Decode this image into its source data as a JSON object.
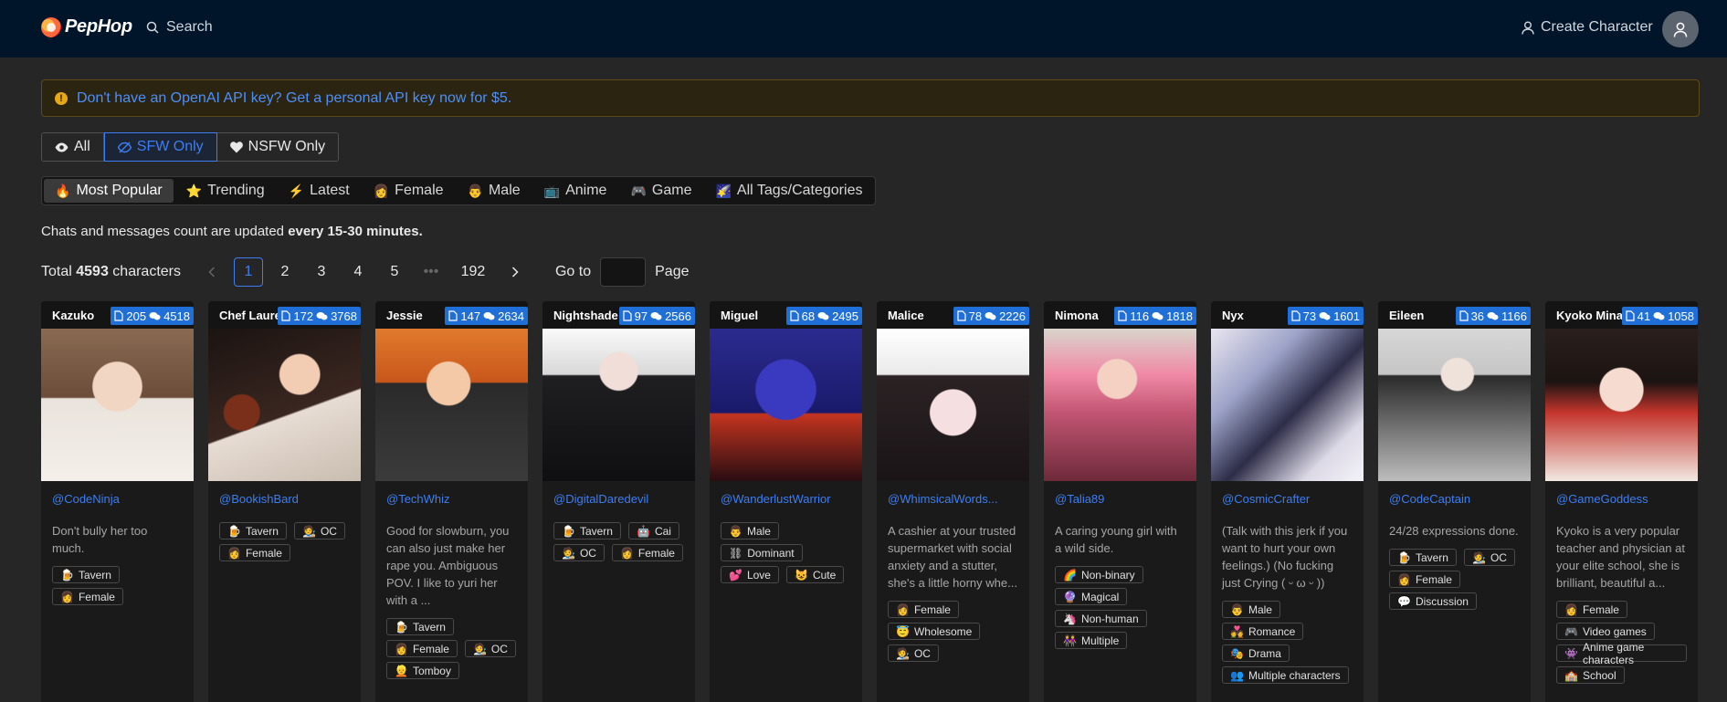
{
  "header": {
    "logo_text": "PepHop",
    "search_label": "Search",
    "create_label": "Create Character"
  },
  "banner": {
    "text": "Don't have an OpenAI API key? Get a personal API key now for $5."
  },
  "filters": [
    {
      "label": "All",
      "icon": "eye-icon"
    },
    {
      "label": "SFW Only",
      "icon": "eye-off-icon"
    },
    {
      "label": "NSFW Only",
      "icon": "heart-icon"
    }
  ],
  "categories": [
    {
      "label": "Most Popular",
      "emoji": "🔥"
    },
    {
      "label": "Trending",
      "emoji": "⭐"
    },
    {
      "label": "Latest",
      "emoji": "⚡"
    },
    {
      "label": "Female",
      "emoji": "👩"
    },
    {
      "label": "Male",
      "emoji": "👨"
    },
    {
      "label": "Anime",
      "emoji": "📺"
    },
    {
      "label": "Game",
      "emoji": "🎮"
    },
    {
      "label": "All Tags/Categories",
      "emoji": "🌠"
    }
  ],
  "notice": {
    "prefix": "Chats and messages count are updated ",
    "bold": "every 15-30 minutes."
  },
  "pagination": {
    "total_prefix": "Total ",
    "total_count": "4593",
    "total_suffix": " characters",
    "pages": [
      "1",
      "2",
      "3",
      "4",
      "5"
    ],
    "ellipsis": "•••",
    "last_page": "192",
    "goto_label": "Go to",
    "page_label": "Page"
  },
  "cards": [
    {
      "name": "Kazuko",
      "chats": "205",
      "messages": "4518",
      "author": "@CodeNinja",
      "desc": "Don't bully her too much.",
      "tags": [
        {
          "e": "🍺",
          "t": "Tavern"
        },
        {
          "e": "👩",
          "t": "Female"
        }
      ]
    },
    {
      "name": "Chef Lauren",
      "chats": "172",
      "messages": "3768",
      "author": "@BookishBard",
      "desc": "",
      "tags": [
        {
          "e": "🍺",
          "t": "Tavern"
        },
        {
          "e": "🧑‍🎨",
          "t": "OC"
        },
        {
          "e": "👩",
          "t": "Female"
        }
      ]
    },
    {
      "name": "Jessie",
      "chats": "147",
      "messages": "2634",
      "author": "@TechWhiz",
      "desc": "Good for slowburn, you can also just make her rape you. Ambiguous POV. I like to yuri her with a ...",
      "tags": [
        {
          "e": "🍺",
          "t": "Tavern"
        },
        {
          "e": "👩",
          "t": "Female"
        },
        {
          "e": "🧑‍🎨",
          "t": "OC"
        },
        {
          "e": "👱",
          "t": "Tomboy"
        }
      ]
    },
    {
      "name": "Nightshade",
      "chats": "97",
      "messages": "2566",
      "author": "@DigitalDaredevil",
      "desc": "",
      "tags": [
        {
          "e": "🍺",
          "t": "Tavern"
        },
        {
          "e": "🤖",
          "t": "Cai"
        },
        {
          "e": "🧑‍🎨",
          "t": "OC"
        },
        {
          "e": "👩",
          "t": "Female"
        }
      ]
    },
    {
      "name": "Miguel",
      "chats": "68",
      "messages": "2495",
      "author": "@WanderlustWarrior",
      "desc": "",
      "tags": [
        {
          "e": "👨",
          "t": "Male"
        },
        {
          "e": "⛓",
          "t": "Dominant"
        },
        {
          "e": "💕",
          "t": "Love"
        },
        {
          "e": "😺",
          "t": "Cute"
        }
      ]
    },
    {
      "name": "Malice",
      "chats": "78",
      "messages": "2226",
      "author": "@WhimsicalWords...",
      "desc": "A cashier at your trusted supermarket with social anxiety and a stutter, she's a little horny whe...",
      "tags": [
        {
          "e": "👩",
          "t": "Female"
        },
        {
          "e": "😇",
          "t": "Wholesome"
        },
        {
          "e": "🧑‍🎨",
          "t": "OC"
        }
      ]
    },
    {
      "name": "Nimona",
      "chats": "116",
      "messages": "1818",
      "author": "@Talia89",
      "desc": "A caring young girl with a wild side.",
      "tags": [
        {
          "e": "🌈",
          "t": "Non-binary"
        },
        {
          "e": "🔮",
          "t": "Magical"
        },
        {
          "e": "🦄",
          "t": "Non-human"
        },
        {
          "e": "👭",
          "t": "Multiple"
        }
      ]
    },
    {
      "name": "Nyx",
      "chats": "73",
      "messages": "1601",
      "author": "@CosmicCrafter",
      "desc": "(Talk with this jerk if you want to hurt your own feelings.) (No fucking just Crying ( ᵕ ω ᵕ ))",
      "tags": [
        {
          "e": "👨",
          "t": "Male"
        },
        {
          "e": "💑",
          "t": "Romance"
        },
        {
          "e": "🎭",
          "t": "Drama"
        },
        {
          "e": "👥",
          "t": "Multiple characters"
        }
      ]
    },
    {
      "name": "Eileen",
      "chats": "36",
      "messages": "1166",
      "author": "@CodeCaptain",
      "desc": "24/28 expressions done.",
      "tags": [
        {
          "e": "🍺",
          "t": "Tavern"
        },
        {
          "e": "🧑‍🎨",
          "t": "OC"
        },
        {
          "e": "👩",
          "t": "Female"
        },
        {
          "e": "💬",
          "t": "Discussion"
        }
      ]
    },
    {
      "name": "Kyoko Minazuki",
      "chats": "41",
      "messages": "1058",
      "author": "@GameGoddess",
      "desc": "Kyoko is a very popular teacher and physician at your elite school, she is brilliant, beautiful a...",
      "tags": [
        {
          "e": "👩",
          "t": "Female"
        },
        {
          "e": "🎮",
          "t": "Video games"
        },
        {
          "e": "👾",
          "t": "Anime game characters"
        },
        {
          "e": "🏫",
          "t": "School"
        }
      ]
    }
  ],
  "colors": {
    "header_bg": "#001529",
    "accent": "#3d7ef2",
    "stats_badge": "#1f6fd6",
    "banner_border": "#5b4a1a",
    "warning": "#e6a817"
  }
}
